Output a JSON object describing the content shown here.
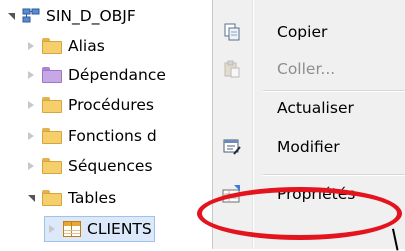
{
  "tree": {
    "root": {
      "label": "SIN_D_OBJF",
      "icon": "database-schema-icon"
    },
    "items": [
      {
        "label": "Alias",
        "color": "#f4cf6c",
        "icon": "folder-icon"
      },
      {
        "label": "Dépendance",
        "color": "#c7a8e6",
        "icon": "folder-icon"
      },
      {
        "label": "Procédures",
        "color": "#f4cf6c",
        "icon": "folder-icon"
      },
      {
        "label": "Fonctions d",
        "color": "#f4cf6c",
        "icon": "folder-icon"
      },
      {
        "label": "Séquences",
        "color": "#f4cf6c",
        "icon": "folder-icon"
      },
      {
        "label": "Tables",
        "color": "#f4cf6c",
        "icon": "folder-icon"
      }
    ],
    "child": {
      "label": "CLIENTS",
      "icon": "table-icon"
    }
  },
  "context_menu": {
    "items": [
      {
        "label": "Copier",
        "icon": "copy-icon",
        "enabled": true
      },
      {
        "label": "Coller...",
        "icon": "paste-icon",
        "enabled": false
      },
      {
        "label": "Actualiser",
        "icon": "",
        "enabled": true
      },
      {
        "label": "Modifier",
        "icon": "edit-icon",
        "enabled": true
      },
      {
        "label": "Propriétés",
        "icon": "properties-icon",
        "enabled": true
      }
    ]
  },
  "annotation": {
    "color": "#e4141f"
  }
}
